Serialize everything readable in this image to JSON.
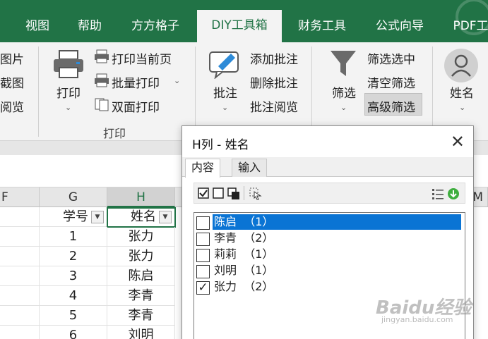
{
  "ribbon_tabs": [
    "视图",
    "帮助",
    "方方格子",
    "DIY工具箱",
    "财务工具",
    "公式向导",
    "PDF工具"
  ],
  "ribbon_active_tab": "DIY工具箱",
  "ribbon": {
    "left_items": [
      "图片",
      "截图",
      "阅览"
    ],
    "print_big": "打印",
    "print_items": [
      "打印当前页",
      "批量打印",
      "双面打印"
    ],
    "print_group": "打印",
    "comment_big": "批注",
    "comment_items": [
      "添加批注",
      "删除批注",
      "批注阅览"
    ],
    "filter_big": "筛选",
    "filter_items": [
      "筛选选中",
      "清空筛选",
      "高级筛选"
    ],
    "name_big": "姓名"
  },
  "sheet": {
    "columns": [
      "F",
      "G",
      "H",
      "M"
    ],
    "header_row": [
      "学号",
      "姓名"
    ],
    "rows": [
      [
        "1",
        "张力"
      ],
      [
        "2",
        "张力"
      ],
      [
        "3",
        "陈启"
      ],
      [
        "4",
        "李青"
      ],
      [
        "5",
        "李青"
      ],
      [
        "6",
        "刘明"
      ]
    ]
  },
  "dialog": {
    "title": "H列 - 姓名",
    "tabs": [
      "内容",
      "输入"
    ],
    "items": [
      {
        "label": "陈启",
        "count": "（1）",
        "checked": false,
        "selected": true
      },
      {
        "label": "李青",
        "count": "（2）",
        "checked": false,
        "selected": false
      },
      {
        "label": "莉莉",
        "count": "（1）",
        "checked": false,
        "selected": false
      },
      {
        "label": "刘明",
        "count": "（1）",
        "checked": false,
        "selected": false
      },
      {
        "label": "张力",
        "count": "（2）",
        "checked": true,
        "selected": false
      }
    ]
  },
  "watermark": {
    "main": "Baidu经验",
    "sub": "jingyan.baidu.com"
  },
  "colors": {
    "excel_green": "#217346",
    "selection_blue": "#0a74d4"
  }
}
